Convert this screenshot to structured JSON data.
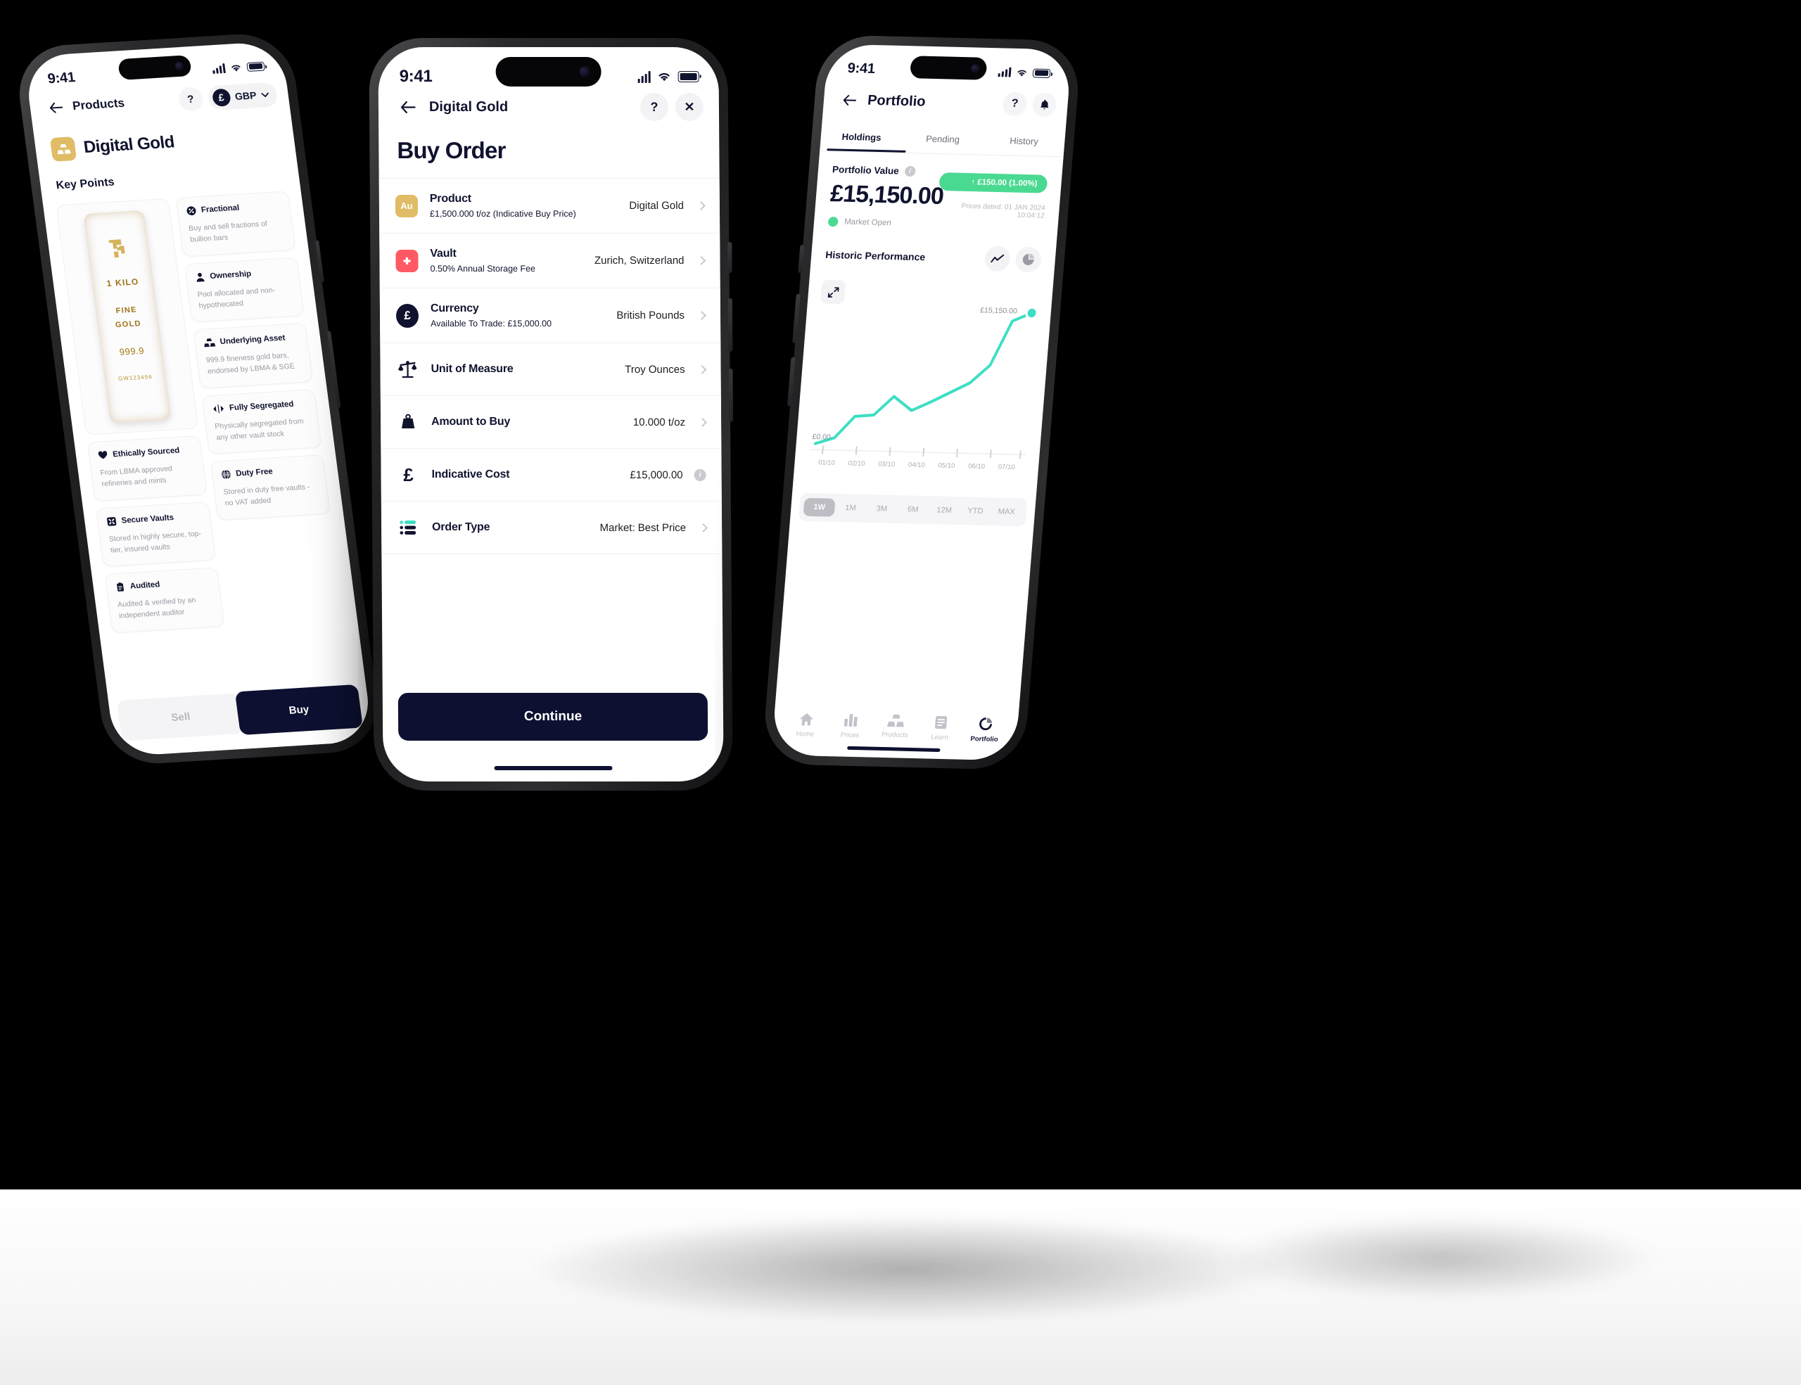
{
  "status_bar": {
    "time": "9:41"
  },
  "phone1": {
    "nav": {
      "back_label": "Products",
      "help_label": "?",
      "currency_code": "GBP",
      "currency_symbol": "£",
      "chevron": "chevron-down"
    },
    "product_title": "Digital Gold",
    "section_title": "Key Points",
    "gold_bar": {
      "weight": "1 KILO",
      "purity_line1": "FINE",
      "purity_line2": "GOLD",
      "fineness": "999.9",
      "serial": "GW123456"
    },
    "key_points": [
      {
        "icon": "percent-icon",
        "name": "Fractional",
        "desc": "Buy and sell fractions of bullion bars"
      },
      {
        "icon": "person-icon",
        "name": "Ownership",
        "desc": "Pool allocated and non-hypothecated"
      },
      {
        "icon": "gold-bars-icon",
        "name": "Underlying Asset",
        "desc": "999.9 fineness gold bars, endorsed by LBMA & SGE"
      },
      {
        "icon": "heart-leaf-icon",
        "name": "Ethically Sourced",
        "desc": "From LBMA approved refineries and mints"
      },
      {
        "icon": "segregate-icon",
        "name": "Fully Segregated",
        "desc": "Physically segregated from any other vault stock"
      },
      {
        "icon": "vault-icon",
        "name": "Secure Vaults",
        "desc": "Stored in highly secure, top-tier, insured vaults"
      },
      {
        "icon": "globe-icon",
        "name": "Duty Free",
        "desc": "Stored in duty free vaults - no VAT added"
      },
      {
        "icon": "clipboard-icon",
        "name": "Audited",
        "desc": "Audited & verified by an independent auditor"
      }
    ],
    "footer": {
      "sell_label": "Sell",
      "buy_label": "Buy"
    }
  },
  "phone2": {
    "nav": {
      "title": "Digital Gold",
      "help_label": "?",
      "close_label": "✕"
    },
    "page_title": "Buy Order",
    "rows": [
      {
        "icon": "au-badge-icon",
        "label": "Product",
        "sub": "£1,500.000 t/oz (Indicative Buy Price)",
        "value": "Digital Gold",
        "affordance": "chevron"
      },
      {
        "icon": "swiss-flag-icon",
        "label": "Vault",
        "sub": "0.50% Annual Storage Fee",
        "value": "Zurich, Switzerland",
        "affordance": "chevron"
      },
      {
        "icon": "pound-circle-icon",
        "label": "Currency",
        "sub": "Available To Trade: £15,000.00",
        "value": "British Pounds",
        "affordance": "chevron"
      },
      {
        "icon": "scales-icon",
        "label": "Unit of Measure",
        "sub": "",
        "value": "Troy Ounces",
        "affordance": "chevron"
      },
      {
        "icon": "weight-icon",
        "label": "Amount to Buy",
        "sub": "",
        "value": "10.000 t/oz",
        "affordance": "chevron"
      },
      {
        "icon": "pound-icon",
        "label": "Indicative Cost",
        "sub": "",
        "value": "£15,000.00",
        "affordance": "info"
      },
      {
        "icon": "order-list-icon",
        "label": "Order Type",
        "sub": "",
        "value": "Market: Best Price",
        "affordance": "chevron"
      }
    ],
    "continue_label": "Continue"
  },
  "phone3": {
    "nav": {
      "title": "Portfolio",
      "help_label": "?",
      "bell": "bell-icon"
    },
    "tabs": [
      {
        "label": "Holdings",
        "active": true
      },
      {
        "label": "Pending",
        "active": false
      },
      {
        "label": "History",
        "active": false
      }
    ],
    "portfolio": {
      "value_label": "Portfolio Value",
      "value": "£15,150.00",
      "change_chip": "↑ £150.00 (1.00%)",
      "market_status": "Market Open",
      "prices_dated": "Prices dated: 01 JAN 2024 10:04:12"
    },
    "historic": {
      "title": "Historic Performance",
      "line_chart_icon": "line-chart-icon",
      "pie_chart_icon": "pie-chart-icon",
      "expand_icon": "expand-icon"
    },
    "ranges": [
      {
        "label": "1W",
        "active": true
      },
      {
        "label": "1M",
        "active": false
      },
      {
        "label": "3M",
        "active": false
      },
      {
        "label": "6M",
        "active": false
      },
      {
        "label": "12M",
        "active": false
      },
      {
        "label": "YTD",
        "active": false
      },
      {
        "label": "MAX",
        "active": false
      }
    ],
    "tabbar": [
      {
        "icon": "home-icon",
        "label": "Home",
        "active": false
      },
      {
        "icon": "prices-icon",
        "label": "Prices",
        "active": false
      },
      {
        "icon": "products-icon",
        "label": "Products",
        "active": false
      },
      {
        "icon": "learn-icon",
        "label": "Learn",
        "active": false
      },
      {
        "icon": "portfolio-icon",
        "label": "Portfolio",
        "active": true
      }
    ]
  },
  "chart_data": {
    "type": "line",
    "title": "Historic Performance",
    "x": [
      "01/10",
      "02/10",
      "03/10",
      "04/10",
      "05/10",
      "06/10",
      "07/10"
    ],
    "xlabel": "",
    "ylabel": "",
    "ylim": [
      0,
      15150
    ],
    "y_top_label": "£15,150.00",
    "y_bottom_label": "£0.00",
    "grid": false,
    "legend": "none",
    "line_color": "#3ddfc4",
    "values": [
      200,
      900,
      3300,
      3500,
      5600,
      4100,
      5100,
      6200,
      7300,
      9300,
      14200,
      15150
    ],
    "endpoint_label": "£15,150.00"
  },
  "colors": {
    "ink": "#10132e",
    "gold": "#e0bc66",
    "mint": "#3ddfc4",
    "green": "#4ad991",
    "red": "#ff5a64",
    "muted": "#9a9aa2"
  }
}
